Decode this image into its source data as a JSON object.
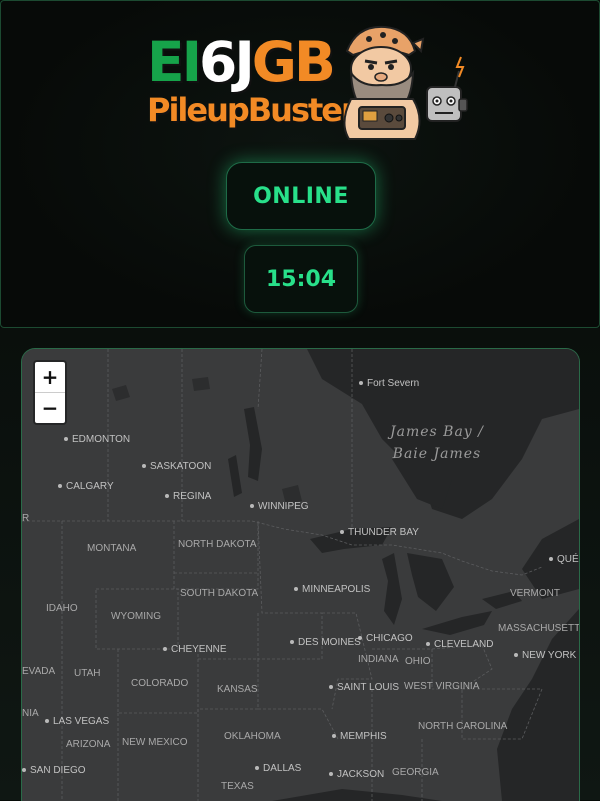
{
  "header": {
    "logo": {
      "call_letters": [
        "E",
        "I",
        "6",
        "J",
        "G",
        "B"
      ],
      "letter_colors": [
        "#16a34a",
        "#16a34a",
        "#ffffff",
        "#ffffff",
        "#f28a25",
        "#f28a25"
      ],
      "tagline": "PileupBuster",
      "mascot": "bearded-radio-operator-icon"
    },
    "status": "ONLINE",
    "clock": "15:04",
    "accent_color": "#28e08a"
  },
  "map": {
    "zoom_in": "+",
    "zoom_out": "−",
    "water_labels": {
      "line1": "James Bay /",
      "line2": "Baie James"
    },
    "cities": {
      "fort_severn": "Fort Severn",
      "edmonton": "EDMONTON",
      "saskatoon": "SASKATOON",
      "calgary": "CALGARY",
      "regina": "REGINA",
      "winnipeg": "WINNIPEG",
      "thunder_bay": "THUNDER BAY",
      "quebec": "QUÉBEC",
      "minneapolis": "MINNEAPOLIS",
      "des_moines": "DES MOINES",
      "chicago": "CHICAGO",
      "cleveland": "CLEVELAND",
      "new_york": "NEW YORK",
      "cheyenne": "CHEYENNE",
      "saint_louis": "SAINT LOUIS",
      "las_vegas": "LAS VEGAS",
      "memphis": "MEMPHIS",
      "san_diego": "SAN DIEGO",
      "dallas": "DALLAS",
      "jackson": "JACKSON"
    },
    "states": {
      "montana": "MONTANA",
      "north_dakota": "NORTH DAKOTA",
      "south_dakota": "SOUTH DAKOTA",
      "idaho": "IDAHO",
      "wyoming": "WYOMING",
      "vermont": "VERMONT",
      "massachusetts": "MASSACHUSETTS",
      "nevada": "EVADA",
      "utah": "UTAH",
      "colorado": "COLORADO",
      "kansas": "KANSAS",
      "indiana": "INDIANA",
      "ohio": "OHIO",
      "west_virginia": "WEST VIRGINIA",
      "california": "NIA",
      "arizona": "ARIZONA",
      "new_mexico": "NEW MEXICO",
      "oklahoma": "OKLAHOMA",
      "north_carolina": "NORTH CAROLINA",
      "texas": "TEXAS",
      "georgia": "GEORGIA",
      "edge": "R"
    }
  }
}
